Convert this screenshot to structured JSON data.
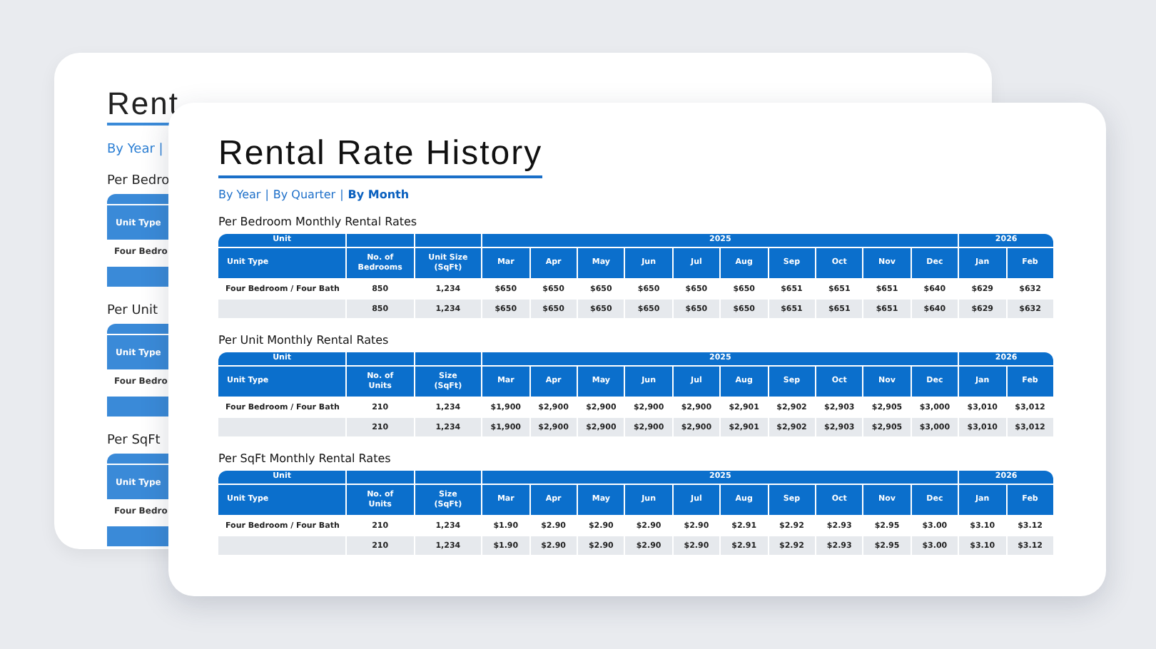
{
  "back_card": {
    "title": "Rent",
    "views": "By Year |",
    "tables": [
      {
        "title": "Per Bedro",
        "header": "Unit Type",
        "row": "Four Bedro"
      },
      {
        "title": "Per Unit",
        "header": "Unit Type",
        "row": "Four Bedro"
      },
      {
        "title": "Per SqFt",
        "header": "Unit Type",
        "row": "Four Bedro"
      }
    ]
  },
  "front_card": {
    "title": "Rental Rate History",
    "separator": "|",
    "views": [
      {
        "label": "By Year",
        "selected": false
      },
      {
        "label": "By Quarter",
        "selected": false
      },
      {
        "label": "By Month",
        "selected": true
      }
    ],
    "tables": [
      {
        "title": "Per Bedroom Monthly Rental Rates",
        "group": "Unit",
        "columns": [
          "Unit Type",
          "No. of Bedrooms",
          "Unit Size (SqFt)"
        ],
        "years": [
          {
            "label": "2025",
            "months": [
              "Mar",
              "Apr",
              "May",
              "Jun",
              "Jul",
              "Aug",
              "Sep",
              "Oct",
              "Nov",
              "Dec"
            ]
          },
          {
            "label": "2026",
            "months": [
              "Jan",
              "Feb"
            ]
          }
        ],
        "rows": [
          {
            "cells": [
              "Four Bedroom / Four Bath",
              "850",
              "1,234",
              "$650",
              "$650",
              "$650",
              "$650",
              "$650",
              "$650",
              "$651",
              "$651",
              "$651",
              "$640",
              "$629",
              "$632"
            ]
          },
          {
            "cells": [
              "",
              "850",
              "1,234",
              "$650",
              "$650",
              "$650",
              "$650",
              "$650",
              "$650",
              "$651",
              "$651",
              "$651",
              "$640",
              "$629",
              "$632"
            ]
          }
        ]
      },
      {
        "title": "Per Unit Monthly Rental Rates",
        "group": "Unit",
        "columns": [
          "Unit Type",
          "No. of Units",
          "Size (SqFt)"
        ],
        "years": [
          {
            "label": "2025",
            "months": [
              "Mar",
              "Apr",
              "May",
              "Jun",
              "Jul",
              "Aug",
              "Sep",
              "Oct",
              "Nov",
              "Dec"
            ]
          },
          {
            "label": "2026",
            "months": [
              "Jan",
              "Feb"
            ]
          }
        ],
        "rows": [
          {
            "cells": [
              "Four Bedroom / Four Bath",
              "210",
              "1,234",
              "$1,900",
              "$2,900",
              "$2,900",
              "$2,900",
              "$2,900",
              "$2,901",
              "$2,902",
              "$2,903",
              "$2,905",
              "$3,000",
              "$3,010",
              "$3,012"
            ]
          },
          {
            "cells": [
              "",
              "210",
              "1,234",
              "$1,900",
              "$2,900",
              "$2,900",
              "$2,900",
              "$2,900",
              "$2,901",
              "$2,902",
              "$2,903",
              "$2,905",
              "$3,000",
              "$3,010",
              "$3,012"
            ]
          }
        ]
      },
      {
        "title": "Per SqFt Monthly Rental Rates",
        "group": "Unit",
        "columns": [
          "Unit Type",
          "No. of Units",
          "Size (SqFt)"
        ],
        "years": [
          {
            "label": "2025",
            "months": [
              "Mar",
              "Apr",
              "May",
              "Jun",
              "Jul",
              "Aug",
              "Sep",
              "Oct",
              "Nov",
              "Dec"
            ]
          },
          {
            "label": "2026",
            "months": [
              "Jan",
              "Feb"
            ]
          }
        ],
        "rows": [
          {
            "cells": [
              "Four Bedroom / Four Bath",
              "210",
              "1,234",
              "$1.90",
              "$2.90",
              "$2.90",
              "$2.90",
              "$2.90",
              "$2.91",
              "$2.92",
              "$2.93",
              "$2.95",
              "$3.00",
              "$3.10",
              "$3.12"
            ]
          },
          {
            "cells": [
              "",
              "210",
              "1,234",
              "$1.90",
              "$2.90",
              "$2.90",
              "$2.90",
              "$2.90",
              "$2.91",
              "$2.92",
              "$2.93",
              "$2.95",
              "$3.00",
              "$3.10",
              "$3.12"
            ]
          }
        ]
      }
    ]
  }
}
